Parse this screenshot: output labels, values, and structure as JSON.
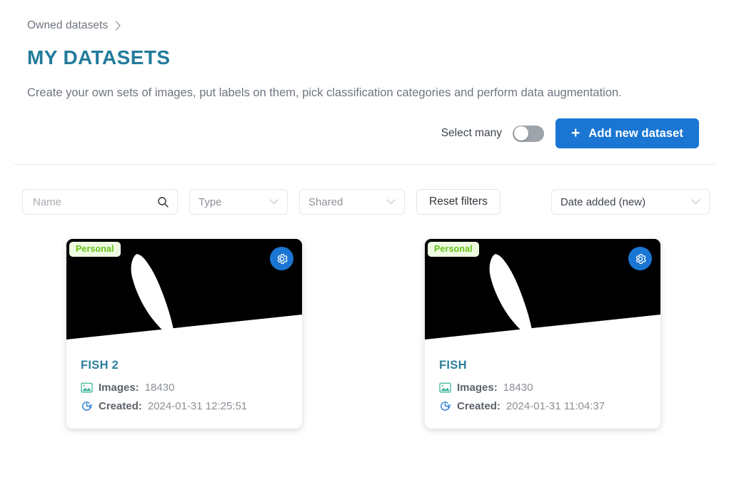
{
  "breadcrumb": {
    "label": "Owned datasets",
    "chevron_icon": "chevron-right-icon"
  },
  "header": {
    "title": "MY DATASETS",
    "subtitle": "Create your own sets of images, put labels on them, pick classification categories and perform data augmentation."
  },
  "actions": {
    "select_many_label": "Select many",
    "select_many_on": false,
    "add_button_label": "Add new dataset",
    "add_button_icon": "plus-icon",
    "add_button_color": "#1a76d2"
  },
  "filters": {
    "name": {
      "value": "",
      "placeholder": "Name",
      "icon": "search-icon"
    },
    "type": {
      "value": "Type",
      "icon": "chevron-down-icon"
    },
    "shared": {
      "value": "Shared",
      "icon": "chevron-down-icon"
    },
    "reset_label": "Reset filters",
    "sort": {
      "value": "Date added (new)",
      "icon": "chevron-down-icon"
    }
  },
  "labels": {
    "images": "Images:",
    "created": "Created:",
    "images_icon": "image-icon",
    "created_icon": "clock-icon",
    "gear_icon": "gear-icon"
  },
  "colors": {
    "title_teal": "#227b9b",
    "accent_blue": "#1a76d2",
    "badge_green": "#63c216"
  },
  "datasets": [
    {
      "badge": "Personal",
      "name": "FISH 2",
      "images": "18430",
      "created": "2024-01-31 12:25:51"
    },
    {
      "badge": "Personal",
      "name": "FISH",
      "images": "18430",
      "created": "2024-01-31 11:04:37"
    }
  ]
}
